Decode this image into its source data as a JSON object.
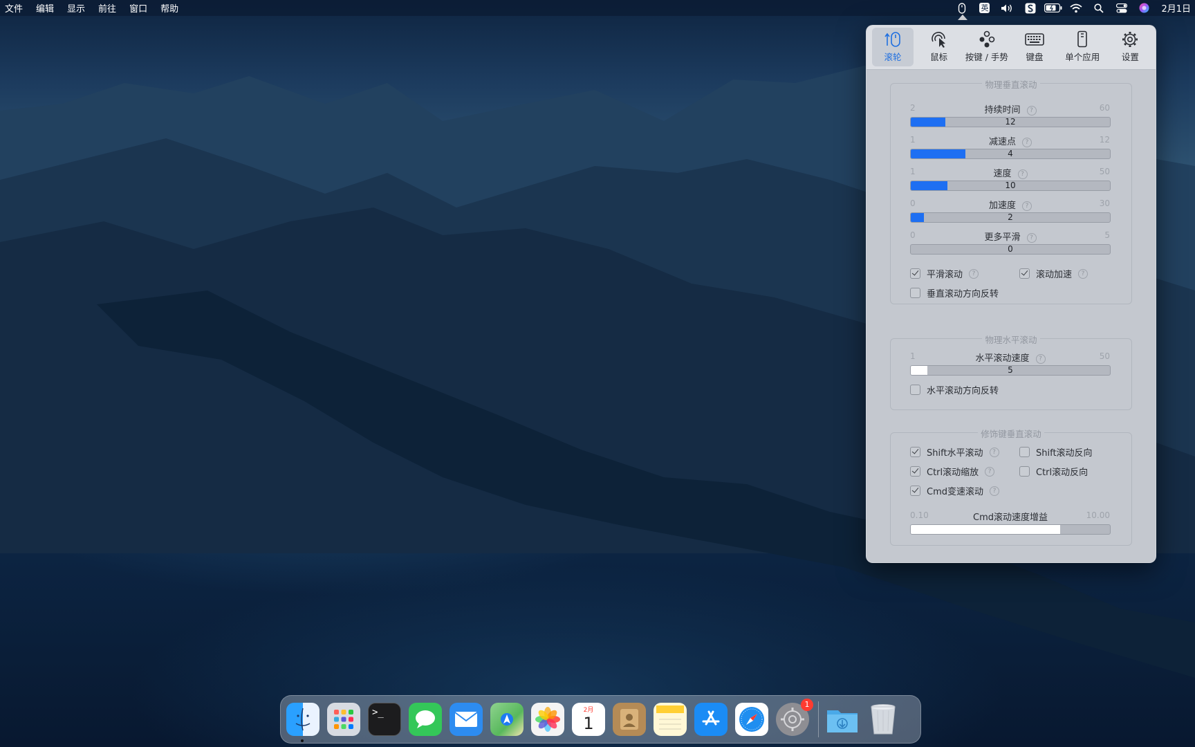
{
  "menubar": {
    "menus": [
      "文件",
      "编辑",
      "显示",
      "前往",
      "窗口",
      "帮助"
    ],
    "status_icons": [
      "mouse-icon",
      "input-source-icon",
      "volume-icon",
      "scroll-app-icon",
      "battery-icon",
      "wifi-icon",
      "search-icon",
      "control-center-icon",
      "siri-icon"
    ],
    "input_source_label": "英",
    "clock": "2月1日"
  },
  "tabs": [
    {
      "label": "滚轮",
      "icon": "scroll-wheel-icon",
      "active": true
    },
    {
      "label": "鼠标",
      "icon": "mouse-pointer-icon",
      "active": false
    },
    {
      "label": "按键 / 手势",
      "icon": "buttons-gesture-icon",
      "active": false
    },
    {
      "label": "键盘",
      "icon": "keyboard-icon",
      "active": false
    },
    {
      "label": "单个应用",
      "icon": "single-app-icon",
      "active": false
    },
    {
      "label": "设置",
      "icon": "gear-icon",
      "active": false
    }
  ],
  "vertical": {
    "title": "物理垂直滚动",
    "sliders": [
      {
        "label": "持续时间",
        "min": "2",
        "max": "60",
        "value": "12",
        "fraction": 0.172
      },
      {
        "label": "减速点",
        "min": "1",
        "max": "12",
        "value": "4",
        "fraction": 0.273
      },
      {
        "label": "速度",
        "min": "1",
        "max": "50",
        "value": "10",
        "fraction": 0.184
      },
      {
        "label": "加速度",
        "min": "0",
        "max": "30",
        "value": "2",
        "fraction": 0.067
      },
      {
        "label": "更多平滑",
        "min": "0",
        "max": "5",
        "value": "0",
        "fraction": 0.0
      }
    ],
    "checkboxes": [
      {
        "label": "平滑滚动",
        "checked": true,
        "help": true
      },
      {
        "label": "滚动加速",
        "checked": true,
        "help": true
      },
      {
        "label": "垂直滚动方向反转",
        "checked": false,
        "help": false
      }
    ]
  },
  "horizontal": {
    "title": "物理水平滚动",
    "slider": {
      "label": "水平滚动速度",
      "min": "1",
      "max": "50",
      "value": "5",
      "fraction": 0.082
    },
    "checkbox": {
      "label": "水平滚动方向反转",
      "checked": false
    }
  },
  "modifier": {
    "title": "修饰键垂直滚动",
    "checkboxes": [
      {
        "label": "Shift水平滚动",
        "checked": true,
        "help": true
      },
      {
        "label": "Shift滚动反向",
        "checked": false,
        "help": false
      },
      {
        "label": "Ctrl滚动缩放",
        "checked": true,
        "help": true
      },
      {
        "label": "Ctrl滚动反向",
        "checked": false,
        "help": false
      },
      {
        "label": "Cmd变速滚动",
        "checked": true,
        "help": true
      }
    ],
    "slider": {
      "label": "Cmd滚动速度增益",
      "min": "0.10",
      "max": "10.00",
      "value": "",
      "fraction": 0.75
    }
  },
  "help_glyph": "?",
  "dock": {
    "apps": [
      {
        "name": "finder",
        "icon": "finder-icon",
        "color": "#1e8bf2"
      },
      {
        "name": "launchpad",
        "icon": "launchpad-icon",
        "color": "#d7dbe2"
      },
      {
        "name": "terminal",
        "icon": "terminal-icon",
        "color": "#1c1c1e"
      },
      {
        "name": "messages",
        "icon": "messages-icon",
        "color": "#34c759"
      },
      {
        "name": "mail",
        "icon": "mail-icon",
        "color": "#2d8cf0"
      },
      {
        "name": "maps",
        "icon": "maps-icon",
        "color": "#58b85c"
      },
      {
        "name": "photos",
        "icon": "photos-icon",
        "color": "#f4f4f4"
      },
      {
        "name": "calendar",
        "icon": "calendar-icon",
        "color": "#ffffff"
      },
      {
        "name": "contacts",
        "icon": "contacts-icon",
        "color": "#b58b56"
      },
      {
        "name": "notes",
        "icon": "notes-icon",
        "color": "#fff8d6"
      },
      {
        "name": "app-store",
        "icon": "app-store-icon",
        "color": "#1b8cf5"
      },
      {
        "name": "safari",
        "icon": "safari-icon",
        "color": "#1f8ef0"
      },
      {
        "name": "system-preferences",
        "icon": "gear-icon",
        "color": "#8e8e93"
      }
    ],
    "calendar_month": "2月",
    "calendar_day": "1",
    "terminal_prompt": ">_",
    "badge_count": "1",
    "downloads_icon": "downloads-folder-icon",
    "trash_icon": "trash-icon"
  }
}
